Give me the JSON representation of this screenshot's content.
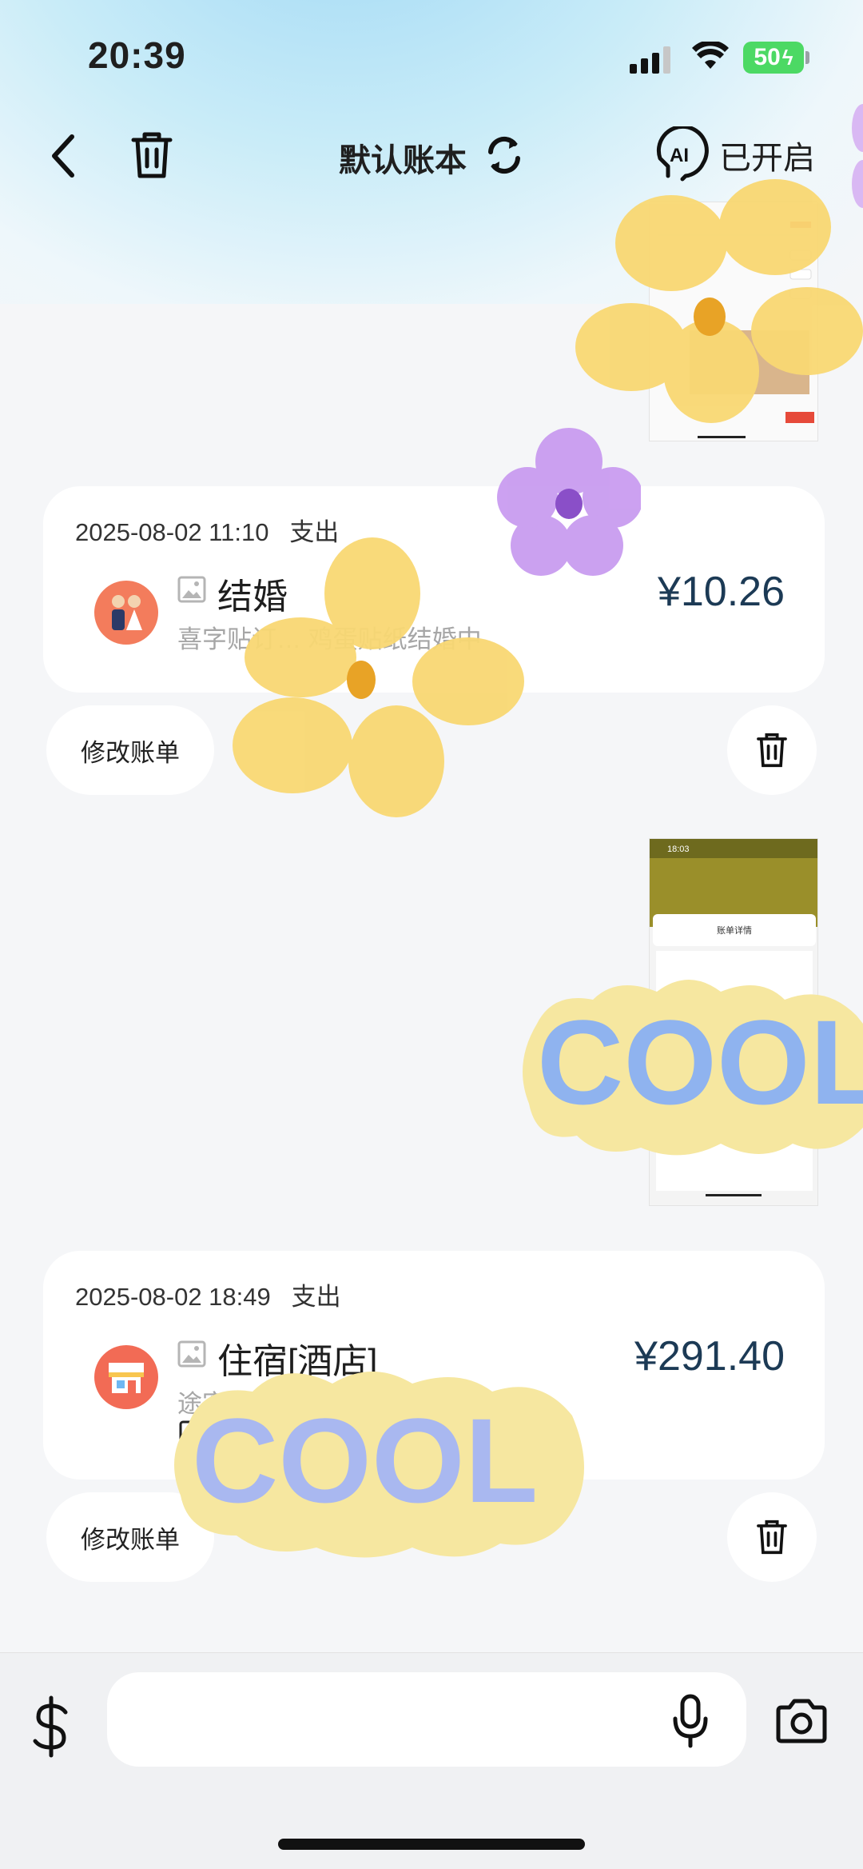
{
  "status_bar": {
    "time": "20:39",
    "battery": "50"
  },
  "nav": {
    "title": "默认账本",
    "ai_label": "已开启",
    "ai_badge": "AI"
  },
  "bills": [
    {
      "datetime": "2025-08-02 11:10",
      "type": "支出",
      "title": "结婚",
      "subtitle": "喜字贴订…  鸡蛋贴纸结婚中",
      "amount": "¥10.26",
      "edit_label": "修改账单"
    },
    {
      "datetime": "2025-08-02 18:49",
      "type": "支出",
      "title": "住宿[酒店]",
      "subtitle": "途客…                                场店）",
      "amount": "¥291.40",
      "edit_label": "修改账单"
    }
  ],
  "thumbnail2": {
    "time": "18:03",
    "header": "账单详情"
  },
  "stickers": {
    "text": "COOL"
  },
  "input": {
    "placeholder": ""
  },
  "colors": {
    "accent_amount": "#1c3a55",
    "flower_yellow": "#f9d873",
    "flower_purple": "#c99cf0"
  }
}
